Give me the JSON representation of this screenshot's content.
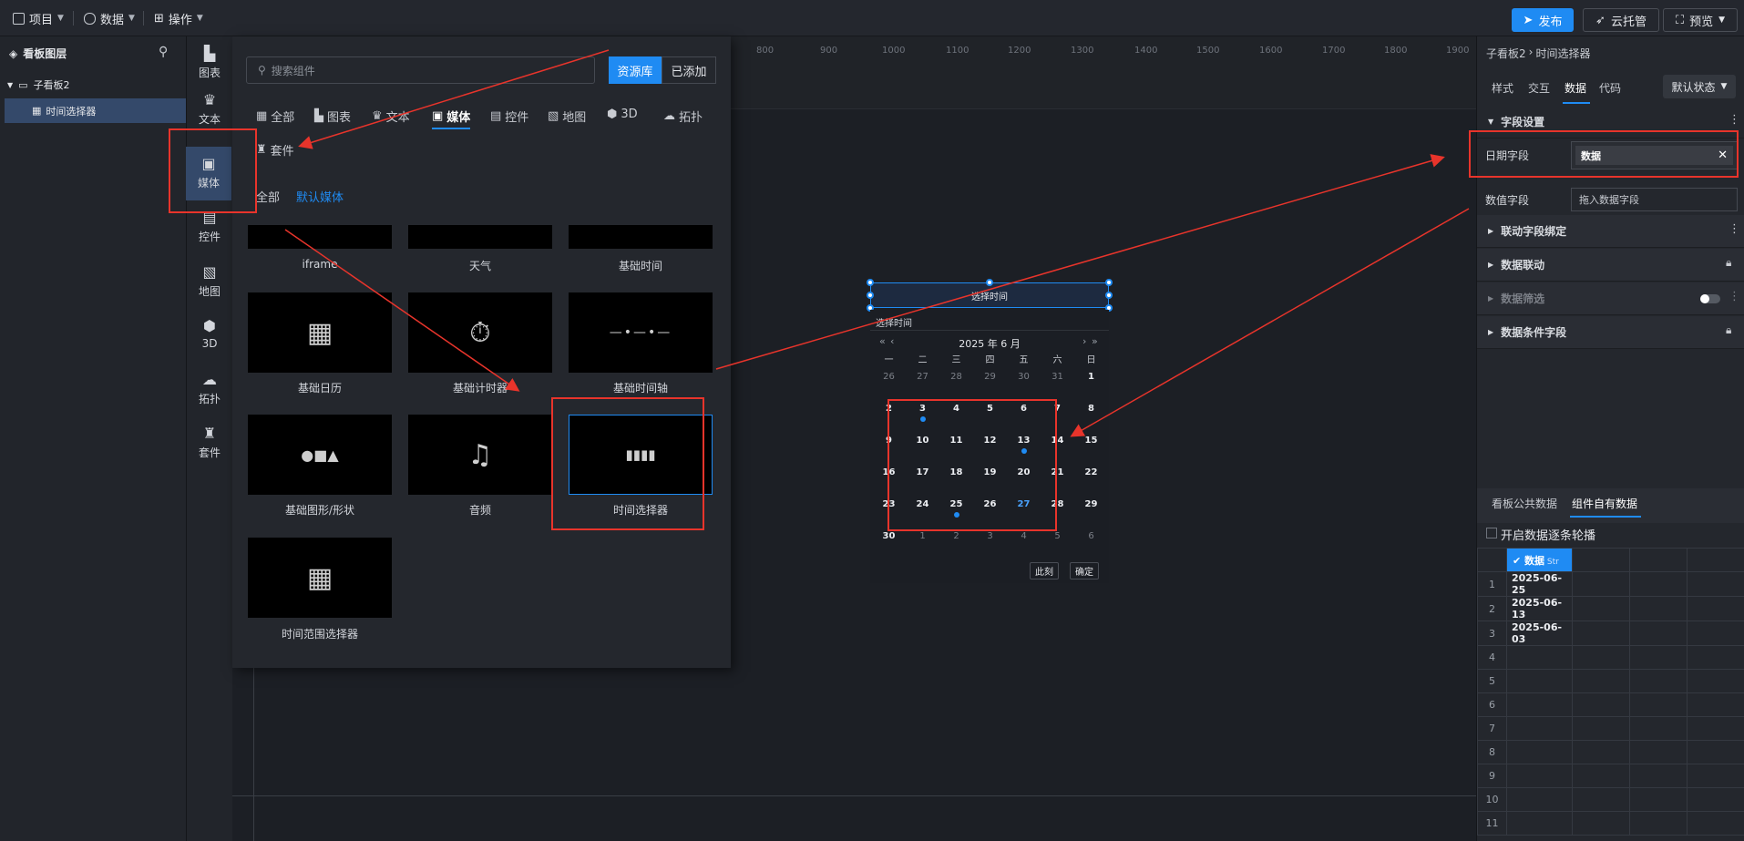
{
  "topbar": {
    "menu": [
      {
        "label": "项目",
        "icon": "file-icon"
      },
      {
        "label": "数据",
        "icon": "database-icon"
      },
      {
        "label": "操作",
        "icon": "grid-icon"
      }
    ],
    "publish": "发布",
    "cloud": "云托管",
    "preview": "预览"
  },
  "layers": {
    "title": "看板图层",
    "board": "子看板2",
    "item": "时间选择器"
  },
  "categories": [
    "图表",
    "文本",
    "媒体",
    "控件",
    "地图",
    "3D",
    "拓扑",
    "套件"
  ],
  "library": {
    "search_placeholder": "搜索组件",
    "tab_resource": "资源库",
    "tab_added": "已添加",
    "tabs": [
      "全部",
      "图表",
      "文本",
      "媒体",
      "控件",
      "地图",
      "3D",
      "拓扑",
      "套件"
    ],
    "sub_all": "全部",
    "sub_default": "默认媒体",
    "items": [
      "iframe",
      "天气",
      "基础时间",
      "基础日历",
      "基础计时器",
      "基础时间轴",
      "基础图形/形状",
      "音频",
      "时间选择器",
      "时间范围选择器"
    ]
  },
  "ruler": [
    "800",
    "900",
    "1000",
    "1100",
    "1200",
    "1300",
    "1400",
    "1500",
    "1600",
    "1700",
    "1800",
    "1900"
  ],
  "widget": {
    "button": "选择时间",
    "header": "选择时间",
    "month": "2025 年  6 月",
    "weekdays": [
      "一",
      "二",
      "三",
      "四",
      "五",
      "六",
      "日"
    ],
    "days": [
      "26",
      "27",
      "28",
      "29",
      "30",
      "31",
      "1",
      "2",
      "3",
      "4",
      "5",
      "6",
      "7",
      "8",
      "9",
      "10",
      "11",
      "12",
      "13",
      "14",
      "15",
      "16",
      "17",
      "18",
      "19",
      "20",
      "21",
      "22",
      "23",
      "24",
      "25",
      "26",
      "27",
      "28",
      "29",
      "30",
      "1",
      "2",
      "3",
      "4",
      "5",
      "6"
    ],
    "now": "此刻",
    "ok": "确定"
  },
  "right": {
    "breadcrumb_board": "子看板2",
    "breadcrumb_item": "时间选择器",
    "tabs": [
      "样式",
      "交互",
      "数据",
      "代码"
    ],
    "state": "默认状态",
    "section_field": "字段设置",
    "date_label": "日期字段",
    "date_value": "数据",
    "value_label": "数值字段",
    "value_placeholder": "拖入数据字段",
    "sections": [
      "联动字段绑定",
      "数据联动",
      "数据筛选",
      "数据条件字段"
    ],
    "data_tabs": [
      "看板公共数据",
      "组件自有数据"
    ],
    "carousel": "开启数据逐条轮播",
    "col_header": "数据",
    "col_type": "Str",
    "rows": [
      "2025-06-25",
      "2025-06-13",
      "2025-06-03",
      "",
      "",
      "",
      "",
      "",
      "",
      "",
      ""
    ]
  },
  "colors": {
    "accent": "#1f8bf3",
    "annotation": "#e8342b"
  }
}
